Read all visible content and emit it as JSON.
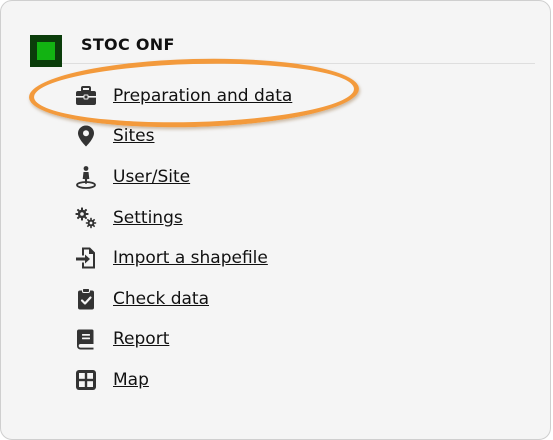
{
  "colors": {
    "panel_bg": "#f5f5f5",
    "logo_dark": "#0b3d0b",
    "logo_light": "#12b312",
    "highlight": "#f39a3c",
    "icon": "#333333"
  },
  "header": {
    "title": "STOC ONF"
  },
  "menu": {
    "items": [
      {
        "label": "Preparation and data",
        "icon": "briefcase-icon"
      },
      {
        "label": "Sites",
        "icon": "map-marker-icon"
      },
      {
        "label": "User/Site",
        "icon": "person-pin-icon"
      },
      {
        "label": "Settings",
        "icon": "gears-icon"
      },
      {
        "label": "Import a shapefile",
        "icon": "file-import-icon"
      },
      {
        "label": "Check data",
        "icon": "clipboard-check-icon"
      },
      {
        "label": "Report",
        "icon": "book-icon"
      },
      {
        "label": "Map",
        "icon": "grid-icon"
      }
    ]
  }
}
